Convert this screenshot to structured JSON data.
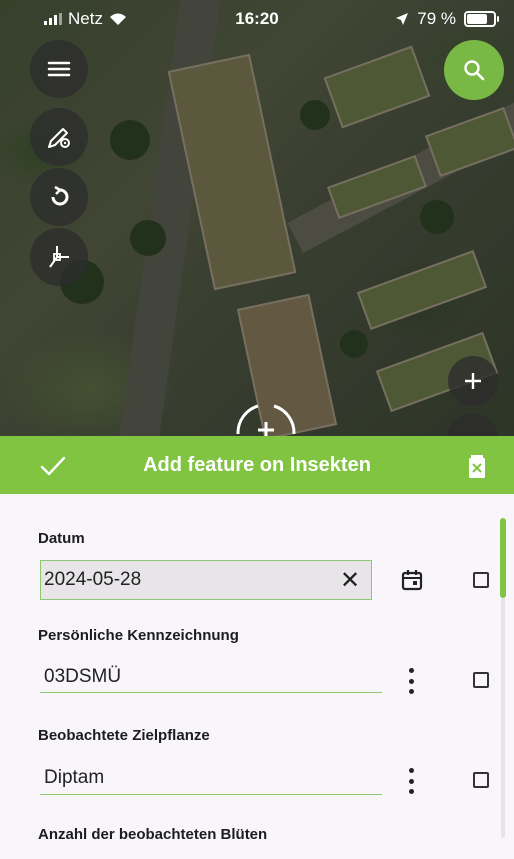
{
  "status_bar": {
    "carrier": "Netz",
    "time": "16:20",
    "battery": "79 %"
  },
  "map_tools": {
    "menu_icon": "menu-icon",
    "digitize_icon": "pencil-gear-icon",
    "undo_icon": "rotate-icon",
    "snapping_icon": "vertex-icon",
    "search_icon": "search-icon",
    "zoom_in_label": "+"
  },
  "header": {
    "title": "Add feature on Insekten",
    "confirm_icon": "check-icon",
    "delete_icon": "trash-icon",
    "color": "#80c442"
  },
  "form": {
    "fields": [
      {
        "label": "Datum",
        "value": "2024-05-28",
        "clear_symbol": "✕"
      },
      {
        "label": "Persönliche Kennzeichnung",
        "value": "03DSMÜ"
      },
      {
        "label": "Beobachtete Zielpflanze",
        "value": "Diptam"
      },
      {
        "label": "Anzahl der beobachteten Blüten",
        "value": ""
      }
    ]
  }
}
